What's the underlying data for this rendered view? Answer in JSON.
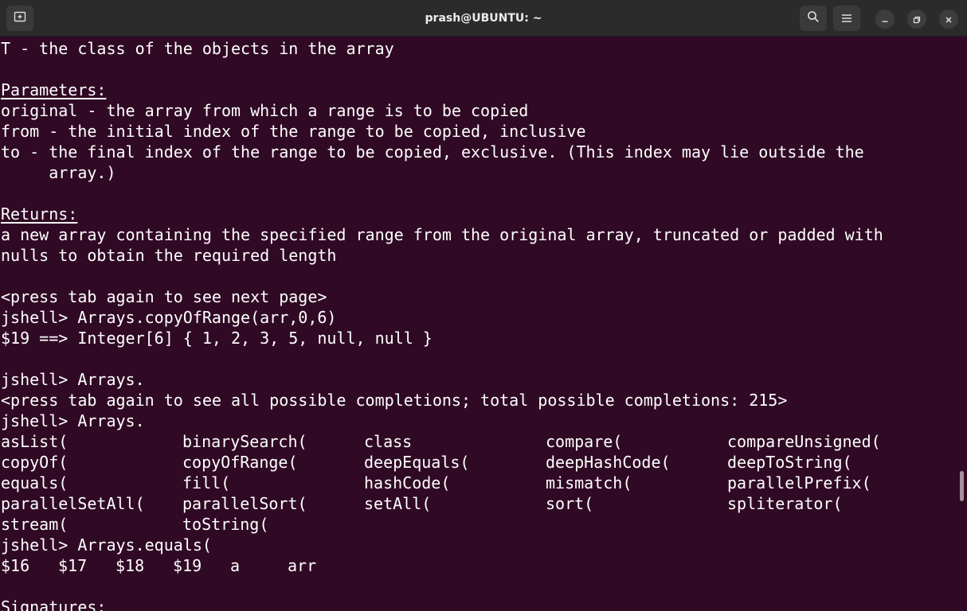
{
  "window": {
    "title": "prash@UBUNTU: ~",
    "icons": {
      "new_tab": "new-tab-icon",
      "search": "search-icon",
      "menu": "hamburger-menu-icon",
      "minimize": "minimize-icon",
      "maximize": "maximize-icon",
      "close": "close-icon"
    }
  },
  "terminal": {
    "lines": [
      "T - the class of the objects in the array",
      "",
      "Parameters:",
      "original - the array from which a range is to be copied",
      "from - the initial index of the range to be copied, inclusive",
      "to - the final index of the range to be copied, exclusive. (This index may lie outside the",
      "     array.)",
      "",
      "Returns:",
      "a new array containing the specified range from the original array, truncated or padded with",
      "nulls to obtain the required length",
      "",
      "<press tab again to see next page>",
      "jshell> Arrays.copyOfRange(arr,0,6)",
      "$19 ==> Integer[6] { 1, 2, 3, 5, null, null }",
      "",
      "jshell> Arrays.",
      "<press tab again to see all possible completions; total possible completions: 215>",
      "jshell> Arrays."
    ],
    "completions": [
      [
        "asList(",
        "binarySearch(",
        "class",
        "compare(",
        "compareUnsigned("
      ],
      [
        "copyOf(",
        "copyOfRange(",
        "deepEquals(",
        "deepHashCode(",
        "deepToString("
      ],
      [
        "equals(",
        "fill(",
        "hashCode(",
        "mismatch(",
        "parallelPrefix("
      ],
      [
        "parallelSetAll(",
        "parallelSort(",
        "setAll(",
        "sort(",
        "spliterator("
      ],
      [
        "stream(",
        "toString("
      ]
    ],
    "after_completions": "jshell> Arrays.equals(",
    "variables": [
      "$16",
      "$17",
      "$18",
      "$19",
      "a",
      "arr"
    ],
    "last_line": "Signatures:"
  },
  "colors": {
    "background": "#300a24",
    "text": "#ffffff",
    "titlebar": "#2b2b2b"
  }
}
